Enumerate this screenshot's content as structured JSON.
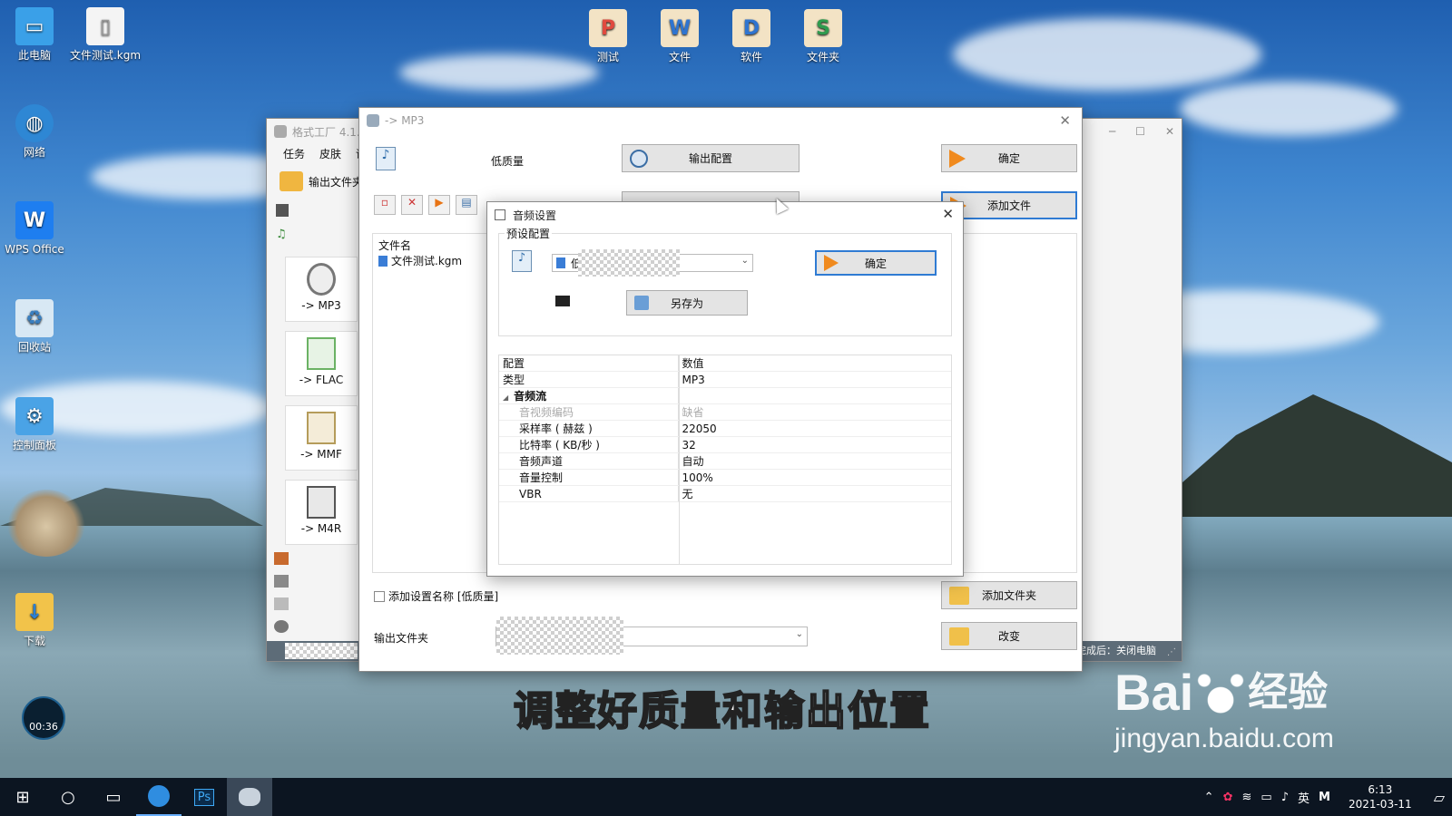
{
  "desktop": {
    "icons": [
      {
        "label": "此电脑"
      },
      {
        "label": "文件测试.kgm"
      },
      {
        "label": "网络"
      },
      {
        "label": "WPS Office"
      },
      {
        "label": "回收站"
      },
      {
        "label": "控制面板"
      },
      {
        "label": "下载"
      },
      {
        "label": "测试"
      },
      {
        "label": "文件"
      },
      {
        "label": "软件"
      },
      {
        "label": "文件夹"
      }
    ],
    "timer": "00:36"
  },
  "back_window": {
    "title": "格式工厂 4.1.0",
    "menu": [
      "任务",
      "皮肤",
      "语"
    ],
    "output_folder_label": "输出文件夹",
    "formats": [
      "-> MP3",
      "-> FLAC",
      "-> MMF",
      "-> M4R"
    ],
    "status_right": "完成后：关闭电脑"
  },
  "mp3_window": {
    "title": "-> MP3",
    "quality": "低质量",
    "output_config": "输出配置",
    "ok": "确定",
    "add_file": "添加文件",
    "column_filename": "文件名",
    "file": "文件测试.kgm",
    "add_setting_name": "添加设置名称 [低质量]",
    "add_folder": "添加文件夹",
    "output_folder": "输出文件夹",
    "change": "改变"
  },
  "audio_dialog": {
    "title": "音频设置",
    "preset_group": "预设配置",
    "preset_value": "低",
    "ok": "确定",
    "save_as": "另存为",
    "table_headers": [
      "配置",
      "数值"
    ],
    "rows": [
      {
        "key": "类型",
        "value": "MP3",
        "dim": false,
        "indent": false
      },
      {
        "key": "音频流",
        "value": "",
        "dim": false,
        "indent": false,
        "group": true
      },
      {
        "key": "音视频编码",
        "value": "缺省",
        "dim": true,
        "indent": true
      },
      {
        "key": "采样率 ( 赫兹 )",
        "value": "22050",
        "dim": false,
        "indent": true
      },
      {
        "key": "比特率 ( KB/秒 )",
        "value": "32",
        "dim": false,
        "indent": true
      },
      {
        "key": "音频声道",
        "value": "自动",
        "dim": false,
        "indent": true
      },
      {
        "key": "音量控制",
        "value": "100%",
        "dim": false,
        "indent": true
      },
      {
        "key": "VBR",
        "value": "无",
        "dim": false,
        "indent": true
      }
    ]
  },
  "subtitle": "调整好质量和输出位置",
  "watermark": {
    "brand": "Bai",
    "brand2": "经验",
    "url": "jingyan.baidu.com"
  },
  "taskbar": {
    "time": "6:13",
    "date": "2021-03-11",
    "ime": "英",
    "ps_label": "Ps"
  }
}
